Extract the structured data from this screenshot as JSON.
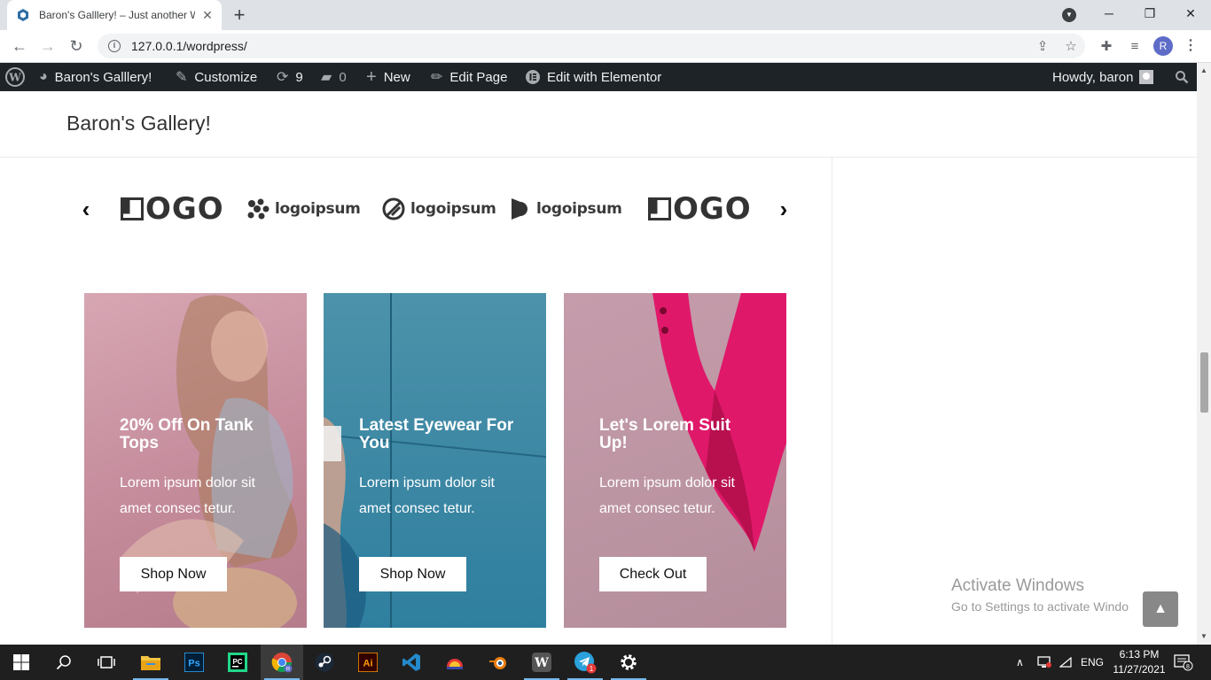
{
  "browser": {
    "tab_title": "Baron's Galllery! – Just another W",
    "url": "127.0.0.1/wordpress/"
  },
  "admin_bar": {
    "site_name": "Baron's Galllery!",
    "customize": "Customize",
    "updates_count": "9",
    "comments_count": "0",
    "new": "New",
    "edit_page": "Edit Page",
    "edit_elementor": "Edit with Elementor",
    "howdy": "Howdy, baron"
  },
  "site": {
    "title": "Baron's Gallery!"
  },
  "logos": [
    {
      "text": "OGO"
    },
    {
      "text": "logoipsum"
    },
    {
      "text": "logoipsum"
    },
    {
      "text": "logoipsum"
    },
    {
      "text": "OGO"
    }
  ],
  "cards": [
    {
      "title": "20% Off On Tank Tops",
      "text": "Lorem ipsum dolor sit amet consec tetur.",
      "button": "Shop Now",
      "bg": "#c98f9e"
    },
    {
      "title": "Latest Eyewear For You",
      "text": "Lorem ipsum dolor sit amet consec tetur.",
      "button": "Shop Now",
      "bg": "#3c87a3"
    },
    {
      "title": "Let's Lorem Suit Up!",
      "text": "Lorem ipsum dolor sit amet consec tetur.",
      "button": "Check Out",
      "bg": "#bd96a4"
    }
  ],
  "watermark": {
    "title": "Activate Windows",
    "subtitle": "Go to Settings to activate Windo"
  },
  "taskbar": {
    "lang": "ENG",
    "time": "6:13 PM",
    "date": "11/27/2021",
    "notif_count": "8",
    "telegram_badge": "1"
  }
}
